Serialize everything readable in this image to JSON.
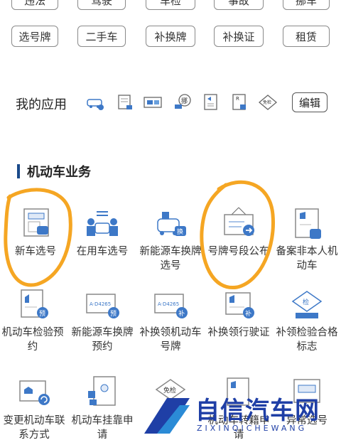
{
  "top_row": [
    "违法",
    "驾驶",
    "车检",
    "事故",
    "挪车"
  ],
  "second_row": [
    "选号牌",
    "二手车",
    "补换牌",
    "补换证",
    "租赁"
  ],
  "my_apps": {
    "title": "我的应用",
    "edit_label": "编辑",
    "icons": [
      "car-exam-icon",
      "document-icon",
      "plate-icon",
      "tag-icon",
      "vehicle-doc-icon",
      "license-icon",
      "exempt-icon"
    ],
    "icon_texts": {
      "tag": "挪",
      "exempt": "免检"
    }
  },
  "section": {
    "title": "机动车业务"
  },
  "tiles": [
    {
      "label": "新车选号",
      "icon": "new-car-plate-icon"
    },
    {
      "label": "在用车选号",
      "icon": "used-car-plate-icon"
    },
    {
      "label": "新能源车换牌选号",
      "icon": "ev-plate-swap-icon",
      "badge": "换"
    },
    {
      "label": "号牌号段公布",
      "icon": "plate-range-announce-icon"
    },
    {
      "label": "备案非本人机动车",
      "icon": "record-vehicle-icon"
    },
    {
      "label": "机动车检验预约",
      "icon": "inspection-booking-icon",
      "badge": "预"
    },
    {
      "label": "新能源车换牌预约",
      "icon": "ev-plate-booking-icon",
      "badge": "预",
      "plate": "A·D4265"
    },
    {
      "label": "补换领机动车号牌",
      "icon": "replace-plate-icon",
      "badge": "补",
      "plate": "A·D4265"
    },
    {
      "label": "补换领行驶证",
      "icon": "replace-license-icon",
      "badge": "补"
    },
    {
      "label": "补领检验合格标志",
      "icon": "inspection-mark-icon",
      "badge": "检"
    },
    {
      "label": "变更机动车联系方式",
      "icon": "change-contact-icon"
    },
    {
      "label": "机动车挂靠申请",
      "icon": "affiliation-icon"
    },
    {
      "label": "",
      "icon": "exempt-mark-icon",
      "badge": "免检"
    },
    {
      "label": "机动车转籍申请",
      "icon": "transfer-icon"
    },
    {
      "label": "异常选号",
      "icon": "abnormal-plate-icon"
    }
  ],
  "watermark": {
    "title": "自信汽车网",
    "subtitle": "ZIXINQICHEWANG"
  },
  "colors": {
    "accent": "#1a4a8a",
    "icon_blue": "#3d78c7",
    "highlight": "#f5a623"
  }
}
